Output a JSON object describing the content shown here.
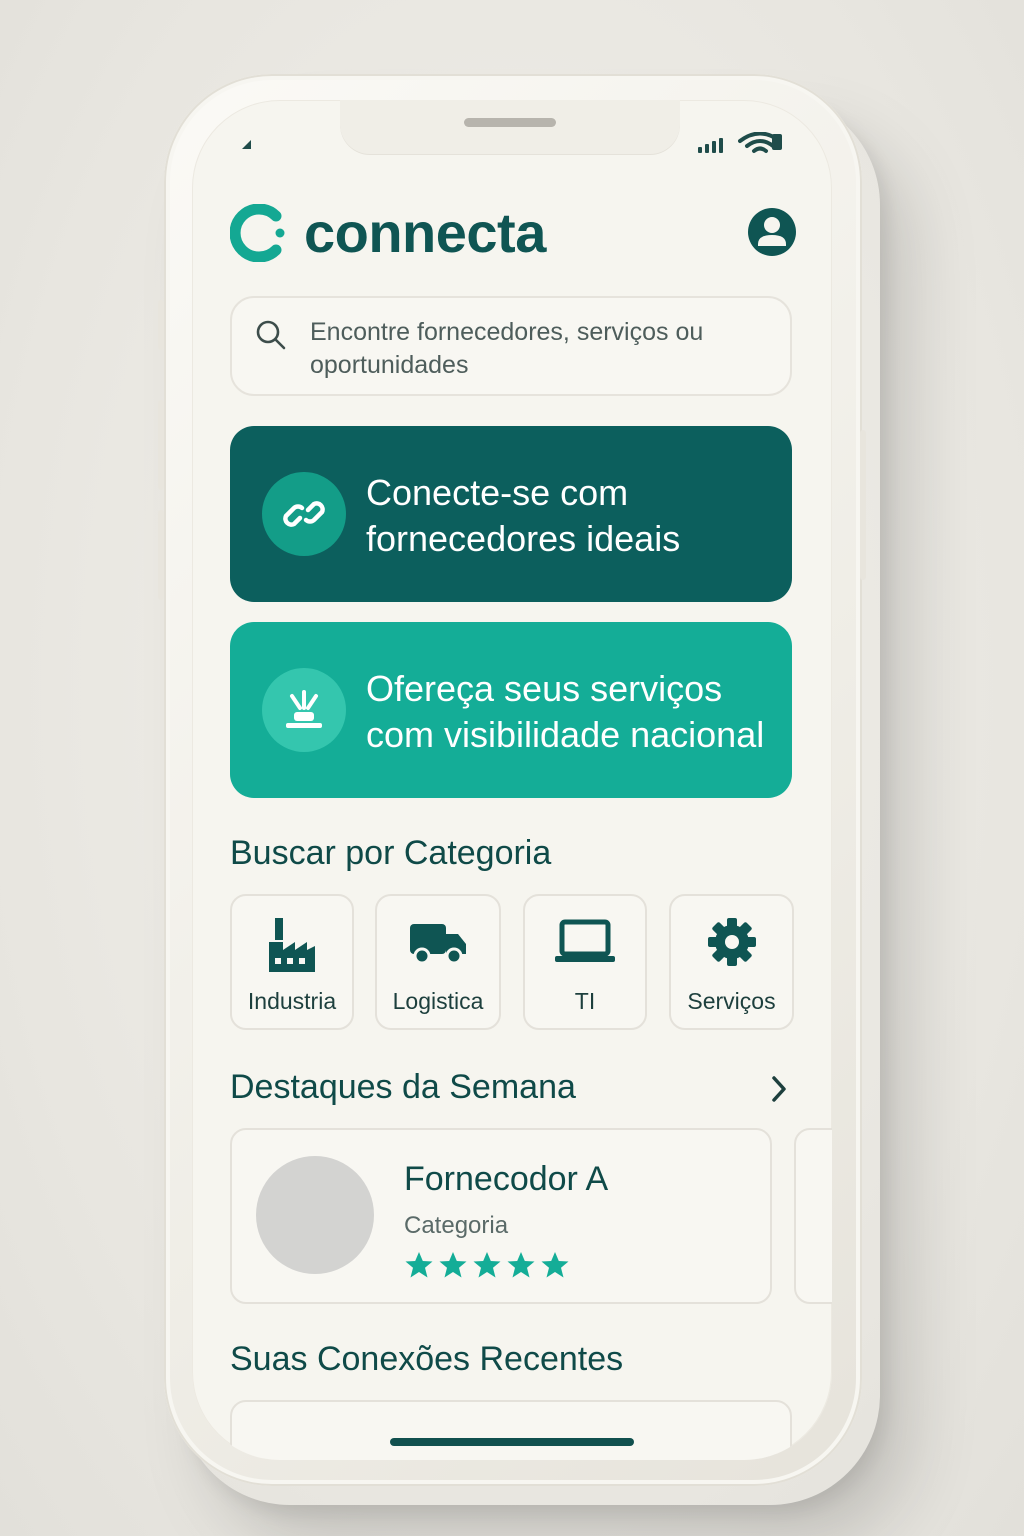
{
  "app": {
    "name": "connecta",
    "accent_dark": "#0c5f5d",
    "accent_light": "#14ad97",
    "text_dark": "#0f4a48"
  },
  "status_bar": {
    "icons": [
      "signal-icon",
      "wifi-icon"
    ]
  },
  "header": {
    "logo_text": "connecta",
    "profile_icon": "user-icon"
  },
  "search": {
    "placeholder": "Encontre fornecedores, serviços ou oportunidades",
    "icon": "search-icon"
  },
  "banners": [
    {
      "text": "Conecte-se com fornecedores ideais",
      "icon": "link-icon",
      "color": "#0c5f5d"
    },
    {
      "text": "Ofereça seus serviços com visibilidade nacional",
      "icon": "broadcast-icon",
      "color": "#14ad97"
    }
  ],
  "categories": {
    "title": "Buscar por Categoria",
    "items": [
      {
        "label": "Industria",
        "icon": "factory-icon"
      },
      {
        "label": "Logistica",
        "icon": "truck-icon"
      },
      {
        "label": "TI",
        "icon": "laptop-icon"
      },
      {
        "label": "Serviços",
        "icon": "gear-icon"
      }
    ]
  },
  "highlights": {
    "title": "Destaques da Semana",
    "more_icon": "chevron-right-icon",
    "cards": [
      {
        "name": "Fornecodor A",
        "category": "Categoria",
        "rating": 5,
        "rating_max": 5
      }
    ]
  },
  "recent": {
    "title": "Suas Conexões Recentes"
  }
}
